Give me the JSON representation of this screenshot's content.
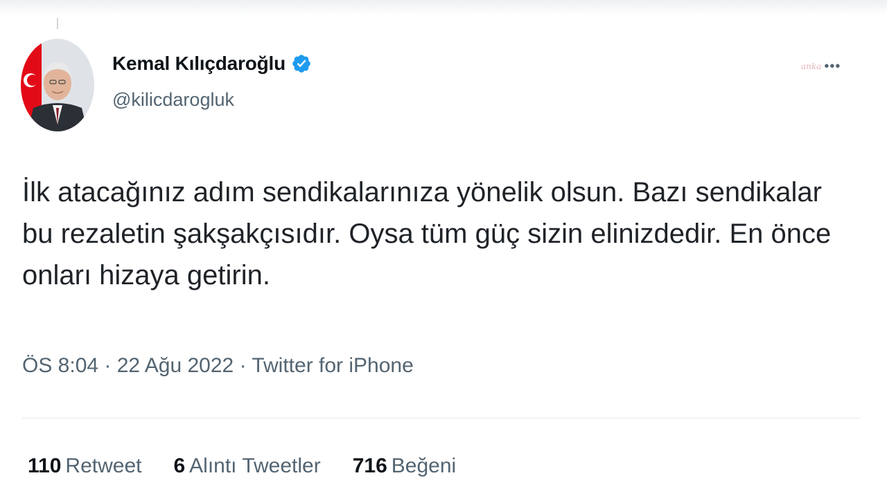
{
  "tweet": {
    "author_name": "Kemal Kılıçdaroğlu",
    "handle": "@kilicdarogluk",
    "verified": true,
    "text": "İlk atacağınız adım sendikalarınıza yönelik olsun. Bazı sendikalar bu rezaletin şakşakçısıdır. Oysa tüm güç sizin elinizdedir. En önce onları hizaya getirin.",
    "meta": "ÖS 8:04 · 22 Ağu 2022 · Twitter for iPhone"
  },
  "stats": [
    {
      "count": "110",
      "label": "Retweet"
    },
    {
      "count": "6",
      "label": "Alıntı Tweetler"
    },
    {
      "count": "716",
      "label": "Beğeni"
    }
  ],
  "watermark": "anka",
  "icons": {
    "verified": "verified-badge-icon",
    "more": "more-options-icon"
  },
  "colors": {
    "verified_blue": "#1d9bf0",
    "secondary_text": "#536471",
    "flag_red": "#e30a17"
  }
}
